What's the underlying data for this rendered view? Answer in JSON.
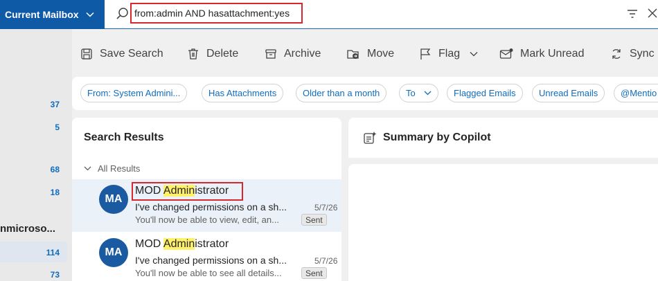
{
  "topbar": {
    "mailbox_label": "Current Mailbox",
    "search_query": "from:admin AND hasattachment:yes"
  },
  "rail": {
    "counts": [
      "37",
      "5",
      "68",
      "18",
      "114",
      "73"
    ],
    "account": "nmicroso..."
  },
  "toolbar": {
    "save_search": "Save Search",
    "delete": "Delete",
    "archive": "Archive",
    "move": "Move",
    "flag": "Flag",
    "mark_unread": "Mark Unread",
    "sync": "Sync"
  },
  "chips": [
    "From: System Admini...",
    "Has Attachments",
    "Older than a month",
    "To",
    "Flagged Emails",
    "Unread Emails",
    "@Mentio"
  ],
  "results": {
    "title": "Search Results",
    "group": "All Results",
    "messages": [
      {
        "avatar": "MA",
        "sender_prefix": "MOD ",
        "sender_highlight": "Admin",
        "sender_suffix": "istrator",
        "subject": "I've changed permissions on a sh...",
        "date": "5/7/26",
        "preview": "You'll now be able to view, edit, an...",
        "tag": "Sent"
      },
      {
        "avatar": "MA",
        "sender_prefix": "MOD ",
        "sender_highlight": "Admin",
        "sender_suffix": "istrator",
        "subject": "I've changed permissions on a sh...",
        "date": "5/7/26",
        "preview": "You'll now be able to see all details...",
        "tag": "Sent"
      }
    ]
  },
  "copilot": {
    "title": "Summary by Copilot"
  },
  "colors": {
    "brand": "#0f6cbd",
    "highlight": "#fff16b",
    "annotation": "#d7262c"
  }
}
